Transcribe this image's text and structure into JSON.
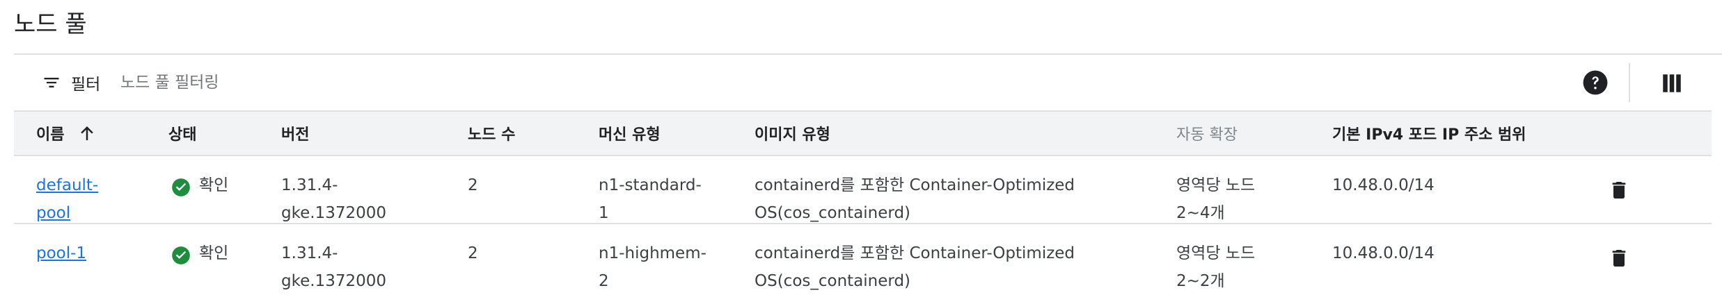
{
  "page": {
    "title": "노드 풀"
  },
  "toolbar": {
    "filter_label": "필터",
    "filter_placeholder": "노드 풀 필터링",
    "help_icon": "help-icon",
    "columns_icon": "column-display-icon"
  },
  "table": {
    "headers": {
      "name": "이름",
      "status": "상태",
      "version": "버전",
      "node_count": "노드 수",
      "machine_type": "머신 유형",
      "image_type": "이미지 유형",
      "autoscaling": "자동 확장",
      "pod_range": "기본 IPv4 포드 IP 주소 범위"
    },
    "sort": {
      "column": "name",
      "direction": "ascending",
      "icon": "arrow-upward-icon"
    },
    "rows": [
      {
        "name_line1": "default-",
        "name_line2": "pool",
        "status": "확인",
        "status_icon": "check-circle-icon",
        "version_line1": "1.31.4-",
        "version_line2": "gke.1372000",
        "node_count": "2",
        "machine_line1": "n1-standard-",
        "machine_line2": "1",
        "image_line1": "containerd를 포함한 Container-Optimized",
        "image_line2": "OS(cos_containerd)",
        "autoscale_line1": "영역당 노드",
        "autoscale_line2": "2~4개",
        "pod_range": "10.48.0.0/14",
        "delete_icon": "trash-icon"
      },
      {
        "name_line1": "pool-1",
        "name_line2": "",
        "status": "확인",
        "status_icon": "check-circle-icon",
        "version_line1": "1.31.4-",
        "version_line2": "gke.1372000",
        "node_count": "2",
        "machine_line1": "n1-highmem-",
        "machine_line2": "2",
        "image_line1": "containerd를 포함한 Container-Optimized",
        "image_line2": "OS(cos_containerd)",
        "autoscale_line1": "영역당 노드",
        "autoscale_line2": "2~2개",
        "pod_range": "10.48.0.0/14",
        "delete_icon": "trash-icon"
      }
    ]
  },
  "colors": {
    "link": "#1a73e8",
    "success": "#1e8e3e",
    "header_bg": "#f1f3f4",
    "divider": "#e0e0e0",
    "text": "#3c4043",
    "muted_header": "#80868b"
  }
}
